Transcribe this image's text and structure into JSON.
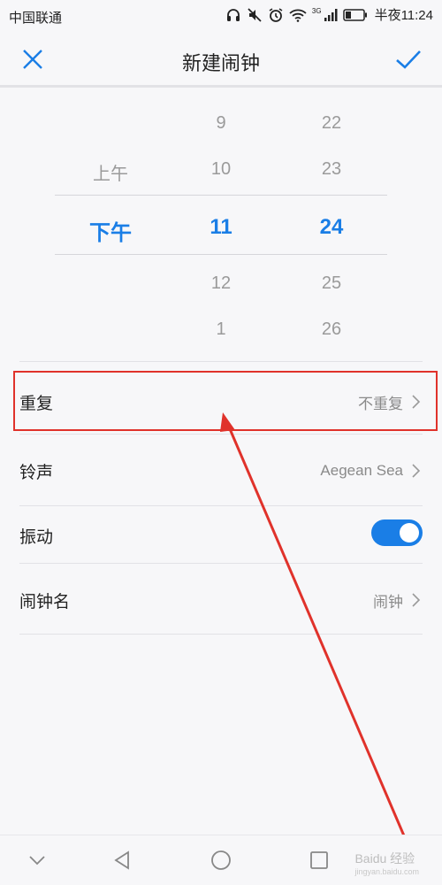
{
  "status_bar": {
    "carrier": "中国联通",
    "network": "3G",
    "clock": "半夜11:24",
    "icons": [
      "headphones-icon",
      "mute-icon",
      "alarm-icon",
      "wifi-icon",
      "signal-icon",
      "battery-icon"
    ]
  },
  "header": {
    "title": "新建闹钟",
    "close_icon": "close-icon",
    "confirm_icon": "checkmark-icon",
    "accent_color": "#1a7ee6"
  },
  "picker": {
    "ampm": [
      "",
      "上午",
      "下午",
      "",
      ""
    ],
    "hours": [
      "9",
      "10",
      "11",
      "12",
      "1"
    ],
    "minutes": [
      "22",
      "23",
      "24",
      "25",
      "26"
    ],
    "selected": {
      "ampm": "下午",
      "hour": "11",
      "minute": "24"
    }
  },
  "settings": {
    "repeat": {
      "label": "重复",
      "value": "不重复"
    },
    "ringtone": {
      "label": "铃声",
      "value": "Aegean Sea"
    },
    "vibrate": {
      "label": "振动",
      "on": true
    },
    "name": {
      "label": "闹钟名",
      "value": "闹钟"
    }
  },
  "annotation": {
    "color": "#e0322b"
  },
  "watermark": {
    "text": "Baidu 经验",
    "sub": "jingyan.baidu.com"
  }
}
